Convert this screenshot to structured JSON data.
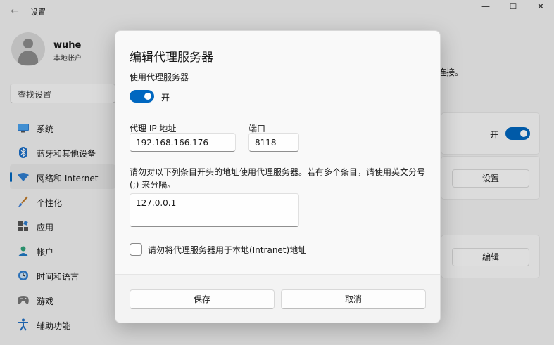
{
  "window": {
    "title": "设置",
    "back": "←",
    "minimize": "—",
    "maximize": "☐",
    "close": "✕"
  },
  "profile": {
    "name": "wuhe",
    "account_type": "本地帐户"
  },
  "search": {
    "placeholder": "查找设置"
  },
  "sidebar": {
    "items": [
      {
        "label": "系统",
        "icon": "monitor-icon"
      },
      {
        "label": "蓝牙和其他设备",
        "icon": "bluetooth-icon"
      },
      {
        "label": "网络和 Internet",
        "icon": "wifi-icon",
        "active": true
      },
      {
        "label": "个性化",
        "icon": "brush-icon"
      },
      {
        "label": "应用",
        "icon": "apps-icon"
      },
      {
        "label": "帐户",
        "icon": "person-icon"
      },
      {
        "label": "时间和语言",
        "icon": "clock-globe-icon"
      },
      {
        "label": "游戏",
        "icon": "gamepad-icon"
      },
      {
        "label": "辅助功能",
        "icon": "accessibility-icon"
      }
    ]
  },
  "background": {
    "partial_text": "连接。",
    "toggle_label": "开",
    "setup_button": "设置",
    "edit_button": "编辑"
  },
  "dialog": {
    "title": "编辑代理服务器",
    "use_proxy_label": "使用代理服务器",
    "toggle_state": "开",
    "ip_label": "代理 IP 地址",
    "ip_value": "192.168.166.176",
    "port_label": "端口",
    "port_value": "8118",
    "exceptions_note": "请勿对以下列条目开头的地址使用代理服务器。若有多个条目，请使用英文分号 (;) 来分隔。",
    "exceptions_value": "127.0.0.1",
    "local_checkbox_label": "请勿将代理服务器用于本地(Intranet)地址",
    "save_button": "保存",
    "cancel_button": "取消"
  },
  "colors": {
    "accent": "#0067c0",
    "background": "#f3f3f3",
    "dialog": "#f9f9f9"
  }
}
